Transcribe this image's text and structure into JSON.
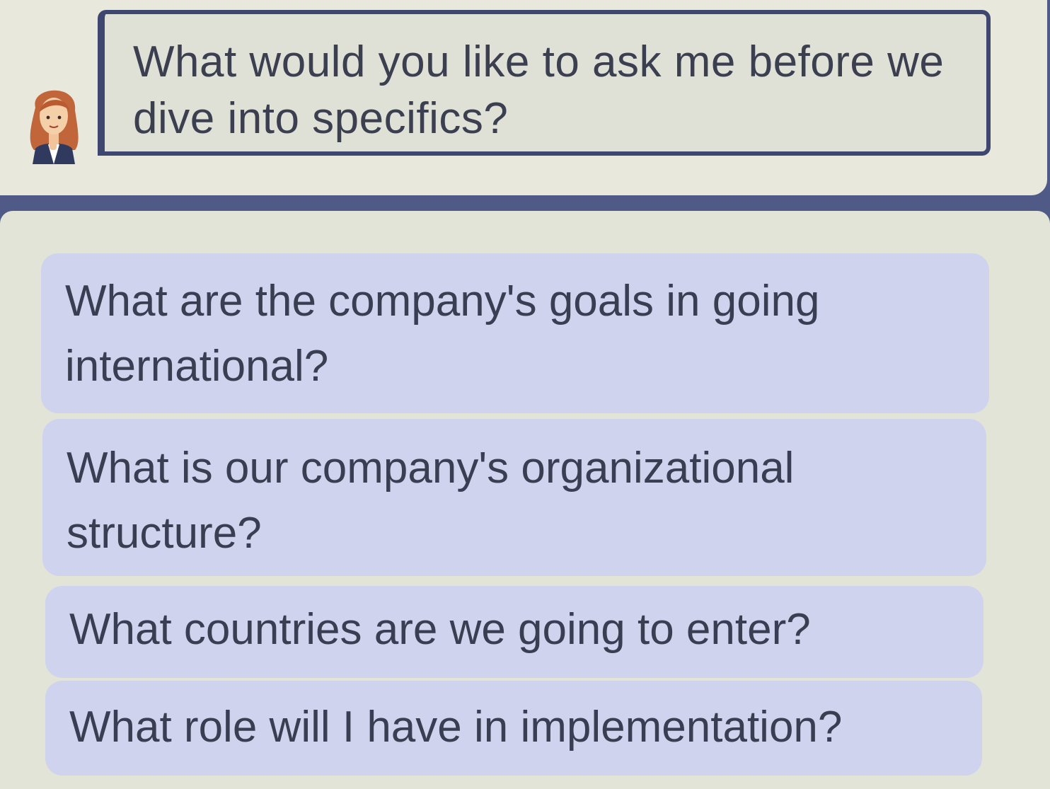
{
  "prompt": {
    "text": "What would you like to ask me before we dive into specifics?"
  },
  "avatar": {
    "icon": "woman-avatar-icon"
  },
  "options": [
    {
      "label": "What are the company's goals in going international?"
    },
    {
      "label": "What is our company's organizational structure?"
    },
    {
      "label": "What countries are we going to enter?"
    },
    {
      "label": "What role will I have in implementation?"
    }
  ],
  "colors": {
    "background": "#4f5a86",
    "panel": "#e3e4d8",
    "option": "#cfd3ee",
    "box_border": "#3e4770",
    "text": "#3a3e52"
  }
}
